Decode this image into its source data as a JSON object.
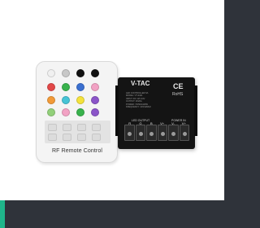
{
  "remote": {
    "label": "RF Remote Control",
    "colors": {
      "white": "#f0f0f0",
      "grey": "#c8c8c8",
      "black": "#111111",
      "red": "#e24848",
      "green": "#38b24c",
      "blue": "#3a6fd0",
      "pink": "#f2a2c4",
      "orange": "#f29a38",
      "cyan": "#46c4d6",
      "yellow": "#f4e23c",
      "light_green": "#92d07a",
      "purple": "#8b55c9"
    }
  },
  "controller": {
    "brand": "V-TAC",
    "ce_mark": "CE",
    "rohs": "RoHS",
    "specs": [
      "LED CONTROLLER 6A",
      "MODEL: VT-2421",
      "INPUT: DC 12V-24V",
      "OUTPUT: 3X20A",
      "POWER: 720W/1440W",
      "FREQUENCY: 433.92MHz"
    ],
    "led_output_label": "LED OUTPUT",
    "power_label": "POWER IN",
    "terminals": [
      "R",
      "G",
      "B",
      "V+",
      "V-",
      "V+"
    ]
  }
}
